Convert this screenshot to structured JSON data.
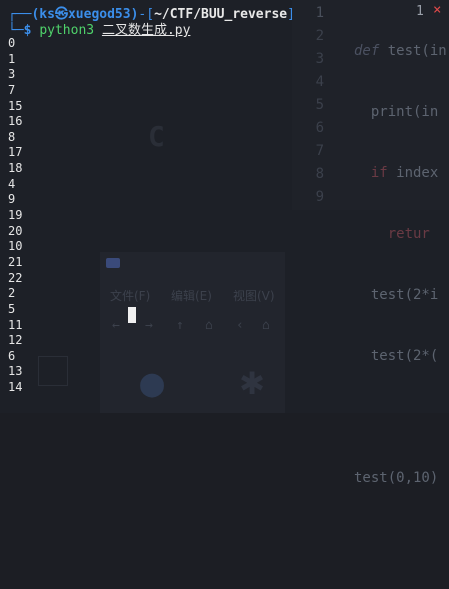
{
  "terminal": {
    "prompt_user": "(ks㉿xuegod53)",
    "prompt_prefix": "┌──",
    "prompt_dash": "-[",
    "prompt_path": "~/CTF/BUU_reverse",
    "prompt_close": "]",
    "prompt2_prefix": "└─",
    "dollar": "$",
    "command": "python3",
    "argument": "二叉数生成.py",
    "output": [
      "0",
      "1",
      "3",
      "7",
      "15",
      "16",
      "8",
      "17",
      "18",
      "4",
      "9",
      "19",
      "20",
      "10",
      "21",
      "22",
      "2",
      "5",
      "11",
      "12",
      "6",
      "13",
      "14"
    ]
  },
  "editor": {
    "line_numbers": [
      "1",
      "2",
      "3",
      "4",
      "5",
      "6",
      "7",
      "8",
      "9"
    ],
    "code_lines": [
      [
        "def ",
        "test(in"
      ],
      [
        "  print(in",
        ""
      ],
      [
        "  if",
        " index"
      ],
      [
        "    retur",
        ""
      ],
      [
        "  test(2*i",
        ""
      ],
      [
        "  test(2*(",
        ""
      ],
      [
        "",
        ""
      ],
      [
        "test(0,10)",
        ""
      ],
      [
        "",
        ""
      ]
    ],
    "badge_count": "1",
    "badge_error": "×"
  },
  "background": {
    "menu": [
      "文件(F)",
      "编辑(E)",
      "视图(V)"
    ],
    "nav_icons": [
      "back-arrow-icon",
      "forward-arrow-icon",
      "up-arrow-icon",
      "home-icon",
      "left-chevron-icon",
      "home-icon"
    ]
  }
}
